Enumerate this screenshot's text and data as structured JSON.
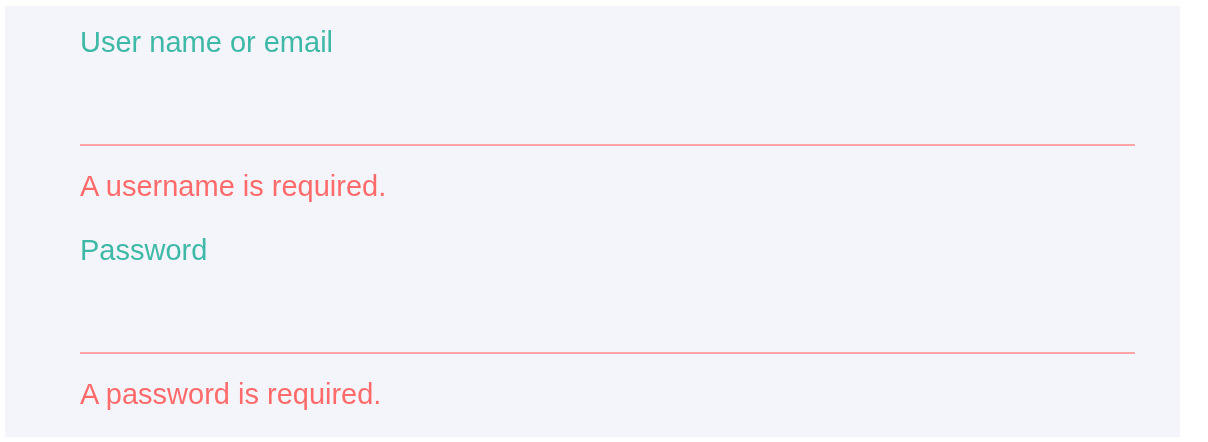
{
  "fields": [
    {
      "label": "User name or email",
      "invalid": true,
      "error": "A username is required."
    },
    {
      "label": "Password",
      "invalid": true,
      "error": "A password is required."
    }
  ]
}
